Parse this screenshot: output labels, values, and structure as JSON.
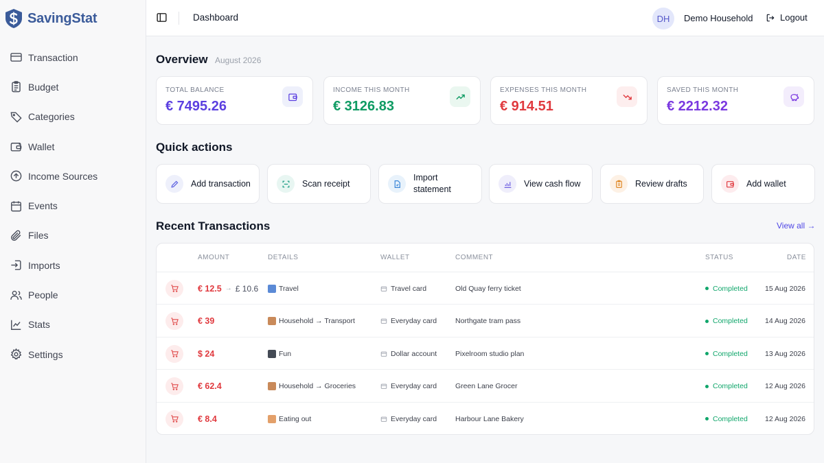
{
  "brand": {
    "name": "SavingStat"
  },
  "sidebar": {
    "items": [
      {
        "label": "Transaction",
        "icon": "credit-card-icon"
      },
      {
        "label": "Budget",
        "icon": "clipboard-list-icon"
      },
      {
        "label": "Categories",
        "icon": "tag-icon"
      },
      {
        "label": "Wallet",
        "icon": "wallet-icon"
      },
      {
        "label": "Income Sources",
        "icon": "arrow-up-circle-icon"
      },
      {
        "label": "Events",
        "icon": "calendar-icon"
      },
      {
        "label": "Files",
        "icon": "paperclip-icon"
      },
      {
        "label": "Imports",
        "icon": "import-icon"
      },
      {
        "label": "People",
        "icon": "users-icon"
      },
      {
        "label": "Stats",
        "icon": "line-chart-icon"
      },
      {
        "label": "Settings",
        "icon": "gear-icon"
      }
    ]
  },
  "header": {
    "title": "Dashboard",
    "avatar_initials": "DH",
    "household": "Demo Household",
    "logout_label": "Logout"
  },
  "overview": {
    "title": "Overview",
    "period": "August 2026",
    "cards": [
      {
        "label": "Total balance",
        "value": "€ 7495.26",
        "color": "#5b3fe0",
        "icon": "wallet-icon",
        "icon_bg": "#eef0fb",
        "icon_color": "#5b3fe0"
      },
      {
        "label": "Income this month",
        "value": "€ 3126.83",
        "color": "#0f9b63",
        "icon": "trending-up-icon",
        "icon_bg": "#eaf7f0",
        "icon_color": "#0f9b63"
      },
      {
        "label": "Expenses this month",
        "value": "€ 914.51",
        "color": "#e0393e",
        "icon": "trending-down-icon",
        "icon_bg": "#fdeeee",
        "icon_color": "#e0393e"
      },
      {
        "label": "Saved this month",
        "value": "€ 2212.32",
        "color": "#7a38e0",
        "icon": "piggy-bank-icon",
        "icon_bg": "#f3edfc",
        "icon_color": "#7a38e0"
      }
    ]
  },
  "quick_actions": {
    "title": "Quick actions",
    "items": [
      {
        "label": "Add transaction",
        "icon": "pencil-icon",
        "bg": "#eef0fb",
        "color": "#5b5fe0"
      },
      {
        "label": "Scan receipt",
        "icon": "scan-icon",
        "bg": "#e8f6f2",
        "color": "#1a9b82"
      },
      {
        "label": "Import statement",
        "icon": "file-import-icon",
        "bg": "#e8f2fb",
        "color": "#3a86d8"
      },
      {
        "label": "View cash flow",
        "icon": "bar-chart-icon",
        "bg": "#efeefb",
        "color": "#6a5ae0"
      },
      {
        "label": "Review drafts",
        "icon": "clipboard-icon",
        "bg": "#fdf1e5",
        "color": "#e08a2a"
      },
      {
        "label": "Add wallet",
        "icon": "wallet-icon",
        "bg": "#fdecee",
        "color": "#e0393e"
      }
    ]
  },
  "recent": {
    "title": "Recent Transactions",
    "view_all": "View all →",
    "columns": {
      "amount": "Amount",
      "details": "Details",
      "wallet": "Wallet",
      "comment": "Comment",
      "status": "Status",
      "date": "Date"
    },
    "rows": [
      {
        "amount": "€ 12.5",
        "converted": "£ 10.6",
        "details": "Travel",
        "wallet": "Travel card",
        "comment": "Old Quay ferry ticket",
        "status": "Completed",
        "date": "15 Aug 2026"
      },
      {
        "amount": "€ 39",
        "converted": "",
        "details": "Household → Transport",
        "wallet": "Everyday card",
        "comment": "Northgate tram pass",
        "status": "Completed",
        "date": "14 Aug 2026"
      },
      {
        "amount": "$ 24",
        "converted": "",
        "details": "Fun",
        "wallet": "Dollar account",
        "comment": "Pixelroom studio plan",
        "status": "Completed",
        "date": "13 Aug 2026"
      },
      {
        "amount": "€ 62.4",
        "converted": "",
        "details": "Household → Groceries",
        "wallet": "Everyday card",
        "comment": "Green Lane Grocer",
        "status": "Completed",
        "date": "12 Aug 2026"
      },
      {
        "amount": "€ 8.4",
        "converted": "",
        "details": "Eating out",
        "wallet": "Everyday card",
        "comment": "Harbour Lane Bakery",
        "status": "Completed",
        "date": "12 Aug 2026"
      }
    ]
  }
}
